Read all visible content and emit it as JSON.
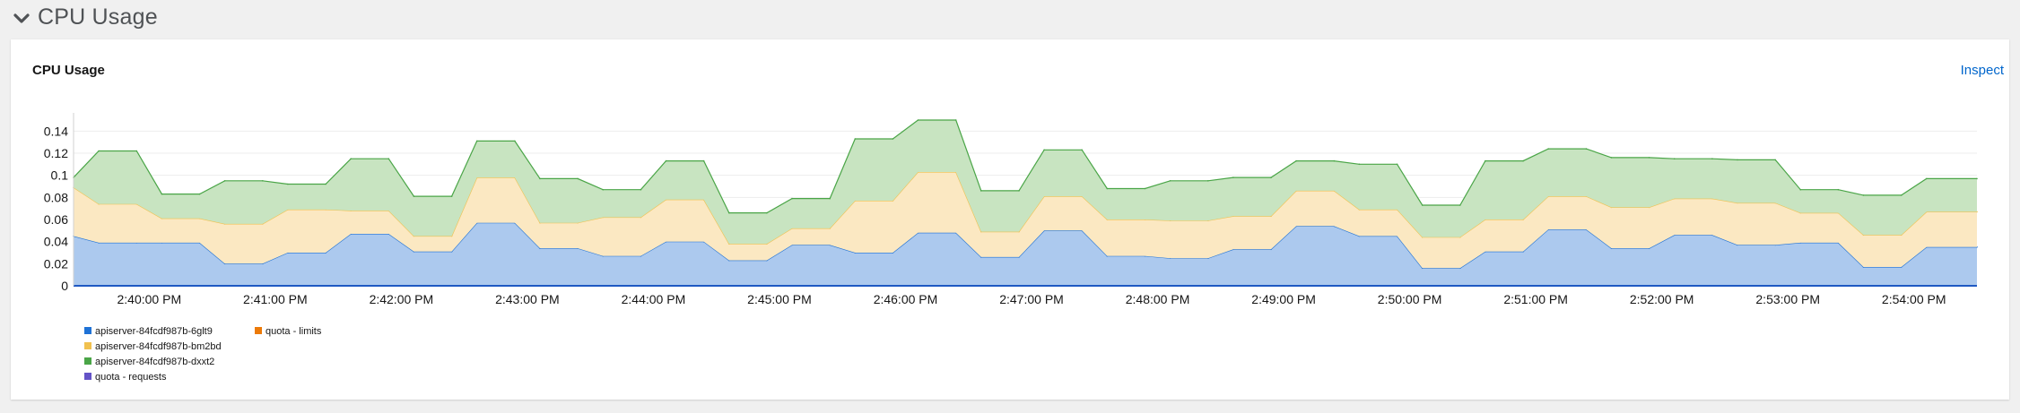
{
  "section": {
    "title": "CPU Usage"
  },
  "card": {
    "title": "CPU Usage",
    "inspect_label": "Inspect"
  },
  "colors": {
    "blue": "#1f72d6",
    "blue_fill": "#acc9ee",
    "yellow": "#f1c14f",
    "yellow_fill": "#fbe8c2",
    "green": "#4aa547",
    "green_fill": "#c8e4c1",
    "orange": "#ec7a08",
    "purple": "#6453c7",
    "section_chevron": "#4f5255"
  },
  "chart_data": {
    "type": "area",
    "stacked": true,
    "ylim": [
      0,
      0.15
    ],
    "xlim": [
      "2:39:24 PM",
      "2:54:30 PM"
    ],
    "yticks": [
      0,
      0.02,
      0.04,
      0.06,
      0.08,
      0.1,
      0.12,
      0.14
    ],
    "ytick_labels": [
      "0",
      "0.02",
      "0.04",
      "0.06",
      "0.08",
      "0.1",
      "0.12",
      "0.14"
    ],
    "xtick_labels": [
      "2:40:00 PM",
      "2:41:00 PM",
      "2:42:00 PM",
      "2:43:00 PM",
      "2:44:00 PM",
      "2:45:00 PM",
      "2:46:00 PM",
      "2:47:00 PM",
      "2:48:00 PM",
      "2:49:00 PM",
      "2:50:00 PM",
      "2:51:00 PM",
      "2:52:00 PM",
      "2:53:00 PM",
      "2:54:00 PM"
    ],
    "grid": true,
    "legend_position": "bottom-left",
    "x": [
      "2:39:24 PM",
      "2:39:36 PM",
      "2:39:54 PM",
      "2:40:06 PM",
      "2:40:24 PM",
      "2:40:36 PM",
      "2:40:54 PM",
      "2:41:06 PM",
      "2:41:24 PM",
      "2:41:36 PM",
      "2:41:54 PM",
      "2:42:06 PM",
      "2:42:24 PM",
      "2:42:36 PM",
      "2:42:54 PM",
      "2:43:06 PM",
      "2:43:24 PM",
      "2:43:36 PM",
      "2:43:54 PM",
      "2:44:06 PM",
      "2:44:24 PM",
      "2:44:36 PM",
      "2:44:54 PM",
      "2:45:06 PM",
      "2:45:24 PM",
      "2:45:36 PM",
      "2:45:54 PM",
      "2:46:06 PM",
      "2:46:24 PM",
      "2:46:36 PM",
      "2:46:54 PM",
      "2:47:06 PM",
      "2:47:24 PM",
      "2:47:36 PM",
      "2:47:54 PM",
      "2:48:06 PM",
      "2:48:24 PM",
      "2:48:36 PM",
      "2:48:54 PM",
      "2:49:06 PM",
      "2:49:24 PM",
      "2:49:36 PM",
      "2:49:54 PM",
      "2:50:06 PM",
      "2:50:24 PM",
      "2:50:36 PM",
      "2:50:54 PM",
      "2:51:06 PM",
      "2:51:24 PM",
      "2:51:36 PM",
      "2:51:54 PM",
      "2:52:06 PM",
      "2:52:24 PM",
      "2:52:36 PM",
      "2:52:54 PM",
      "2:53:06 PM",
      "2:53:24 PM",
      "2:53:36 PM",
      "2:53:54 PM",
      "2:54:06 PM",
      "2:54:30 PM"
    ],
    "series": [
      {
        "name": "apiserver-84fcdf987b-6glt9",
        "color_key": "blue",
        "values": [
          0.045,
          0.039,
          0.039,
          0.039,
          0.039,
          0.02,
          0.02,
          0.03,
          0.03,
          0.047,
          0.047,
          0.031,
          0.031,
          0.057,
          0.057,
          0.034,
          0.034,
          0.027,
          0.027,
          0.04,
          0.04,
          0.023,
          0.023,
          0.037,
          0.037,
          0.03,
          0.03,
          0.048,
          0.048,
          0.026,
          0.026,
          0.05,
          0.05,
          0.027,
          0.027,
          0.025,
          0.025,
          0.033,
          0.033,
          0.054,
          0.054,
          0.045,
          0.045,
          0.016,
          0.016,
          0.031,
          0.031,
          0.051,
          0.051,
          0.034,
          0.034,
          0.046,
          0.046,
          0.037,
          0.037,
          0.039,
          0.039,
          0.017,
          0.017,
          0.035,
          0.035
        ]
      },
      {
        "name": "apiserver-84fcdf987b-bm2bd",
        "color_key": "yellow",
        "values": [
          0.044,
          0.035,
          0.035,
          0.022,
          0.022,
          0.036,
          0.036,
          0.039,
          0.039,
          0.021,
          0.021,
          0.014,
          0.014,
          0.041,
          0.041,
          0.023,
          0.023,
          0.035,
          0.035,
          0.038,
          0.038,
          0.015,
          0.015,
          0.015,
          0.015,
          0.047,
          0.047,
          0.055,
          0.055,
          0.023,
          0.023,
          0.031,
          0.031,
          0.033,
          0.033,
          0.034,
          0.034,
          0.03,
          0.03,
          0.032,
          0.032,
          0.024,
          0.024,
          0.028,
          0.028,
          0.029,
          0.029,
          0.03,
          0.03,
          0.037,
          0.037,
          0.033,
          0.033,
          0.038,
          0.038,
          0.027,
          0.027,
          0.029,
          0.029,
          0.032,
          0.032
        ]
      },
      {
        "name": "apiserver-84fcdf987b-dxxt2",
        "color_key": "green",
        "values": [
          0.009,
          0.048,
          0.048,
          0.022,
          0.022,
          0.039,
          0.039,
          0.023,
          0.023,
          0.047,
          0.047,
          0.036,
          0.036,
          0.033,
          0.033,
          0.04,
          0.04,
          0.025,
          0.025,
          0.035,
          0.035,
          0.028,
          0.028,
          0.027,
          0.027,
          0.056,
          0.056,
          0.047,
          0.047,
          0.037,
          0.037,
          0.042,
          0.042,
          0.028,
          0.028,
          0.036,
          0.036,
          0.035,
          0.035,
          0.027,
          0.027,
          0.041,
          0.041,
          0.029,
          0.029,
          0.053,
          0.053,
          0.043,
          0.043,
          0.045,
          0.045,
          0.036,
          0.036,
          0.039,
          0.039,
          0.021,
          0.021,
          0.036,
          0.036,
          0.03,
          0.03
        ]
      }
    ],
    "legend": [
      {
        "label": "apiserver-84fcdf987b-6glt9",
        "color_key": "blue"
      },
      {
        "label": "quota - limits",
        "color_key": "orange"
      },
      {
        "label": "apiserver-84fcdf987b-bm2bd",
        "color_key": "yellow"
      },
      {
        "label": "apiserver-84fcdf987b-dxxt2",
        "color_key": "green"
      },
      {
        "label": "quota - requests",
        "color_key": "purple"
      }
    ]
  }
}
